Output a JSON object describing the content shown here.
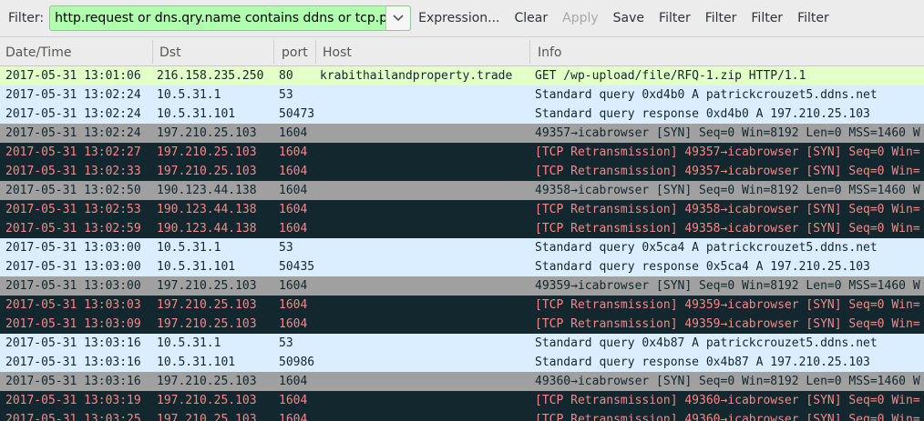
{
  "toolbar": {
    "filter_label": "Filter:",
    "filter_value": "http.request or dns.qry.name contains ddns or tcp.port",
    "expression_label": "Expression...",
    "clear_label": "Clear",
    "apply_label": "Apply",
    "save_label": "Save",
    "filter_buttons": [
      "Filter",
      "Filter",
      "Filter",
      "Filter"
    ]
  },
  "columns": [
    "Date/Time",
    "Dst",
    "port",
    "Host",
    "Info"
  ],
  "colors": {
    "http": "#e4ffc7",
    "dns": "#daeeff",
    "tcp_syn": "#a0a0a0",
    "tcp_retransmission_bg": "#12272e",
    "tcp_retransmission_fg": "#f78787",
    "filter_valid": "#afffaf"
  },
  "packets": [
    {
      "type": "http",
      "time": "2017-05-31 13:01:06",
      "dst": "216.158.235.250",
      "port": "80",
      "host": "krabithailandproperty.trade",
      "info": "GET /wp-upload/file/RFQ-1.zip HTTP/1.1"
    },
    {
      "type": "dns",
      "time": "2017-05-31 13:02:24",
      "dst": "10.5.31.1",
      "port": "53",
      "host": "",
      "info": "Standard query 0xd4b0  A patrickcrouzet5.ddns.net"
    },
    {
      "type": "dns",
      "time": "2017-05-31 13:02:24",
      "dst": "10.5.31.101",
      "port": "50473",
      "host": "",
      "info": "Standard query response 0xd4b0  A 197.210.25.103"
    },
    {
      "type": "syn",
      "time": "2017-05-31 13:02:24",
      "dst": "197.210.25.103",
      "port": "1604",
      "host": "",
      "info": "49357→icabrowser [SYN] Seq=0 Win=8192 Len=0 MSS=1460 W"
    },
    {
      "type": "retr",
      "time": "2017-05-31 13:02:27",
      "dst": "197.210.25.103",
      "port": "1604",
      "host": "",
      "info": "[TCP Retransmission] 49357→icabrowser [SYN] Seq=0 Win="
    },
    {
      "type": "retr",
      "time": "2017-05-31 13:02:33",
      "dst": "197.210.25.103",
      "port": "1604",
      "host": "",
      "info": "[TCP Retransmission] 49357→icabrowser [SYN] Seq=0 Win="
    },
    {
      "type": "syn",
      "time": "2017-05-31 13:02:50",
      "dst": "190.123.44.138",
      "port": "1604",
      "host": "",
      "info": "49358→icabrowser [SYN] Seq=0 Win=8192 Len=0 MSS=1460 W"
    },
    {
      "type": "retr",
      "time": "2017-05-31 13:02:53",
      "dst": "190.123.44.138",
      "port": "1604",
      "host": "",
      "info": "[TCP Retransmission] 49358→icabrowser [SYN] Seq=0 Win="
    },
    {
      "type": "retr",
      "time": "2017-05-31 13:02:59",
      "dst": "190.123.44.138",
      "port": "1604",
      "host": "",
      "info": "[TCP Retransmission] 49358→icabrowser [SYN] Seq=0 Win="
    },
    {
      "type": "dns",
      "time": "2017-05-31 13:03:00",
      "dst": "10.5.31.1",
      "port": "53",
      "host": "",
      "info": "Standard query 0x5ca4  A patrickcrouzet5.ddns.net"
    },
    {
      "type": "dns",
      "time": "2017-05-31 13:03:00",
      "dst": "10.5.31.101",
      "port": "50435",
      "host": "",
      "info": "Standard query response 0x5ca4  A 197.210.25.103"
    },
    {
      "type": "syn",
      "time": "2017-05-31 13:03:00",
      "dst": "197.210.25.103",
      "port": "1604",
      "host": "",
      "info": "49359→icabrowser [SYN] Seq=0 Win=8192 Len=0 MSS=1460 W"
    },
    {
      "type": "retr",
      "time": "2017-05-31 13:03:03",
      "dst": "197.210.25.103",
      "port": "1604",
      "host": "",
      "info": "[TCP Retransmission] 49359→icabrowser [SYN] Seq=0 Win="
    },
    {
      "type": "retr",
      "time": "2017-05-31 13:03:09",
      "dst": "197.210.25.103",
      "port": "1604",
      "host": "",
      "info": "[TCP Retransmission] 49359→icabrowser [SYN] Seq=0 Win="
    },
    {
      "type": "dns",
      "time": "2017-05-31 13:03:16",
      "dst": "10.5.31.1",
      "port": "53",
      "host": "",
      "info": "Standard query 0x4b87  A patrickcrouzet5.ddns.net"
    },
    {
      "type": "dns",
      "time": "2017-05-31 13:03:16",
      "dst": "10.5.31.101",
      "port": "50986",
      "host": "",
      "info": "Standard query response 0x4b87  A 197.210.25.103"
    },
    {
      "type": "syn",
      "time": "2017-05-31 13:03:16",
      "dst": "197.210.25.103",
      "port": "1604",
      "host": "",
      "info": "49360→icabrowser [SYN] Seq=0 Win=8192 Len=0 MSS=1460 W"
    },
    {
      "type": "retr",
      "time": "2017-05-31 13:03:19",
      "dst": "197.210.25.103",
      "port": "1604",
      "host": "",
      "info": "[TCP Retransmission] 49360→icabrowser [SYN] Seq=0 Win="
    },
    {
      "type": "retr",
      "time": "2017-05-31 13:03:25",
      "dst": "197.210.25.103",
      "port": "1604",
      "host": "",
      "info": "[TCP Retransmission] 49360→icabrowser [SYN] Seq=0 Win="
    }
  ]
}
